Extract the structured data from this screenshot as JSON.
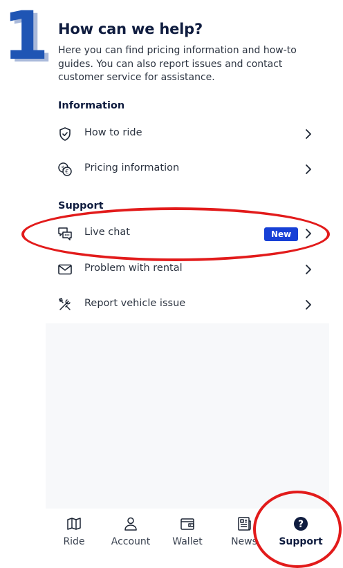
{
  "step_number": "1",
  "header": {
    "title": "How can we help?",
    "subtitle": "Here you can find pricing information and how-to guides. You can also report issues and contact customer service for assistance."
  },
  "sections": {
    "information": {
      "heading": "Information",
      "items": [
        {
          "label": "How to ride",
          "icon": "shield-check-icon"
        },
        {
          "label": "Pricing information",
          "icon": "currency-exchange-icon"
        }
      ]
    },
    "support": {
      "heading": "Support",
      "items": [
        {
          "label": "Live chat",
          "icon": "chat-bubbles-icon",
          "badge": "New"
        },
        {
          "label": "Problem with rental",
          "icon": "envelope-icon"
        },
        {
          "label": "Report vehicle issue",
          "icon": "tools-icon"
        }
      ]
    }
  },
  "bottom_nav": {
    "items": [
      {
        "label": "Ride",
        "icon": "map-icon"
      },
      {
        "label": "Account",
        "icon": "person-icon"
      },
      {
        "label": "Wallet",
        "icon": "wallet-icon"
      },
      {
        "label": "News",
        "icon": "newspaper-icon"
      },
      {
        "label": "Support",
        "icon": "question-circle-icon",
        "active": true
      }
    ]
  },
  "colors": {
    "title": "#0f1c3f",
    "badge": "#1740d6",
    "annotation": "#e21b1b",
    "step_number": "#1f55b4"
  }
}
